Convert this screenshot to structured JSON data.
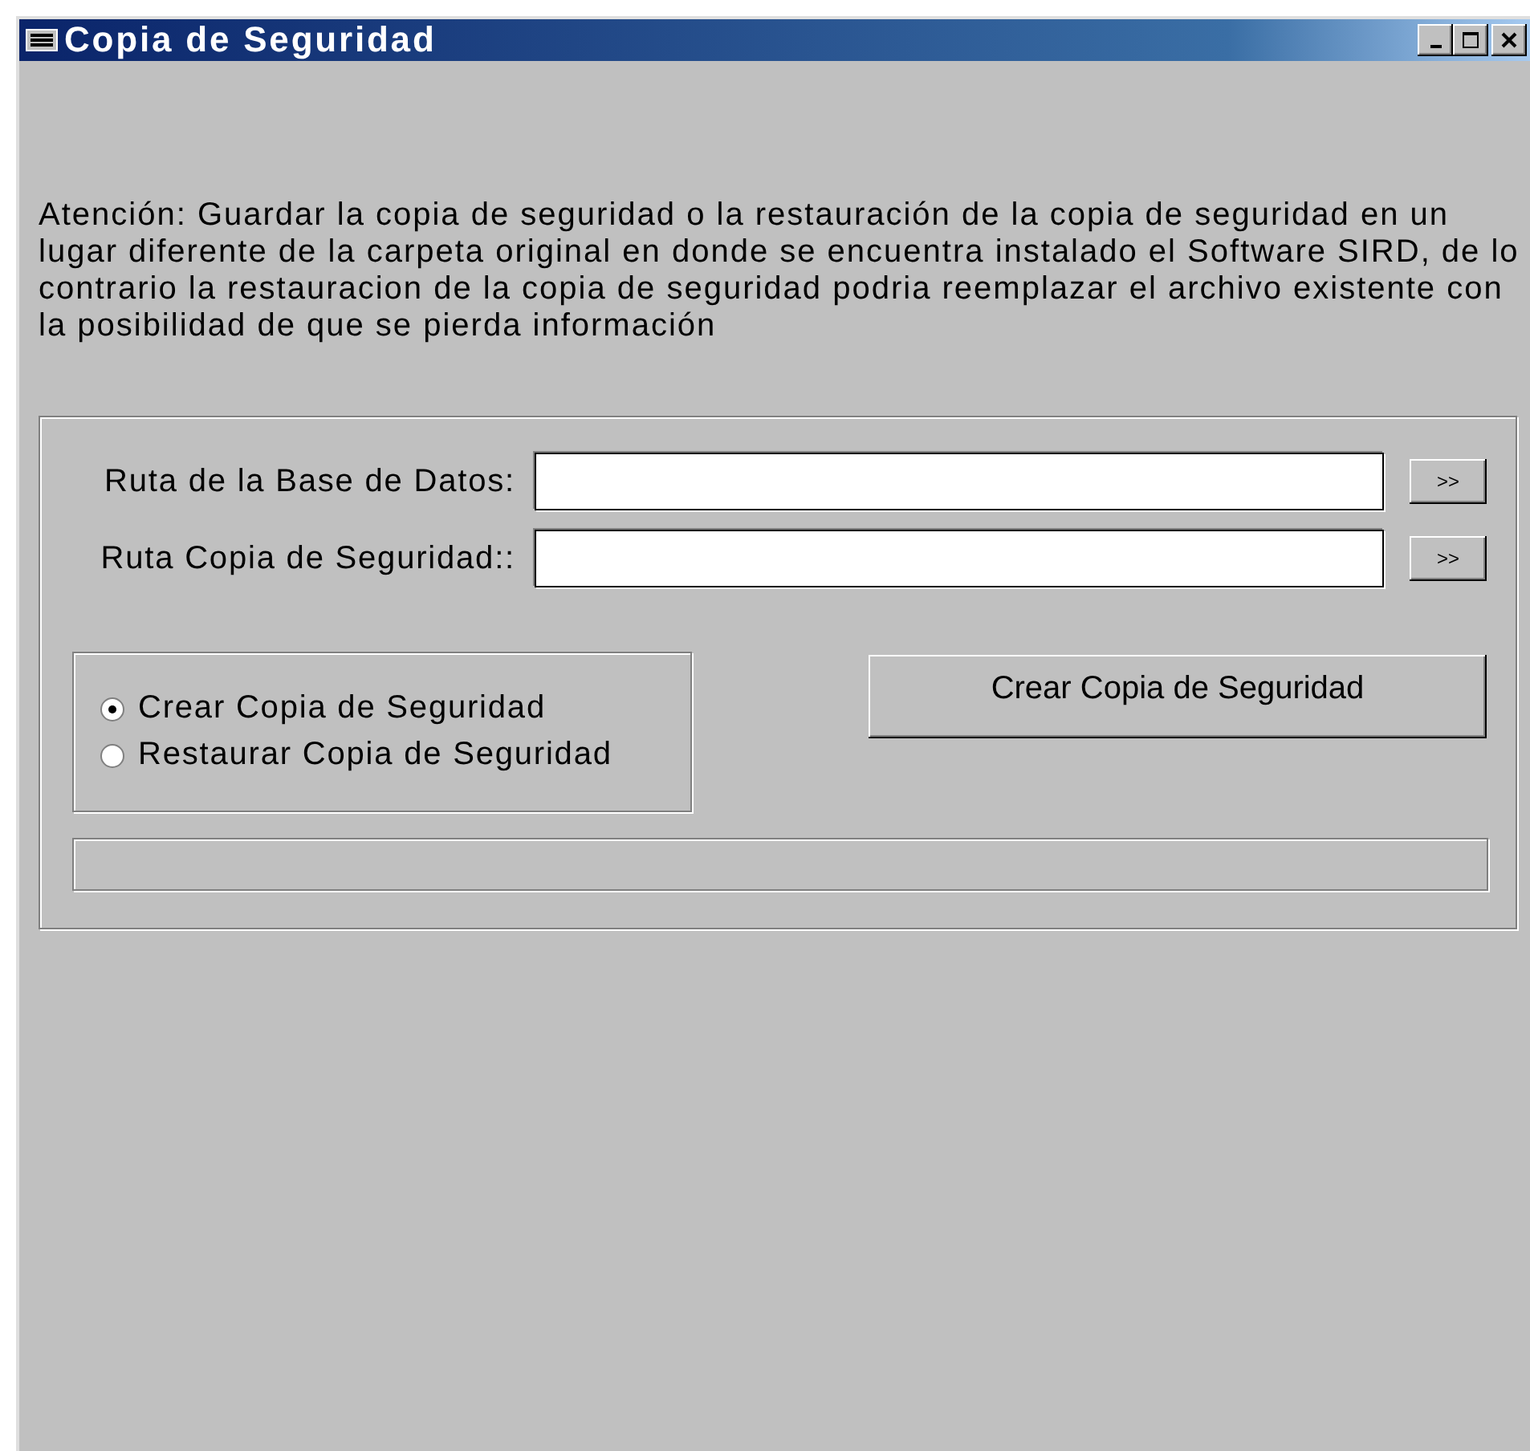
{
  "window": {
    "title": "Copia de Seguridad"
  },
  "message": "Atención: Guardar la copia de seguridad o la restauración de la copia de seguridad en un lugar diferente de la carpeta original en donde se encuentra instalado el Software SIRD, de lo contrario la restauracion de la copia de seguridad podria reemplazar el archivo existente con la posibilidad de que se pierda información",
  "paths": [
    {
      "label": "Ruta de la Base de Datos:",
      "browse": ">>"
    },
    {
      "label": "Ruta Copia de Seguridad::",
      "browse": ">>"
    }
  ],
  "modes": [
    {
      "label": "Crear Copia de Seguridad",
      "selected": true
    },
    {
      "label": "Restaurar Copia de Seguridad",
      "selected": false
    }
  ],
  "action_button": "Crear Copia de Seguridad",
  "progress": {
    "level": 0
  }
}
